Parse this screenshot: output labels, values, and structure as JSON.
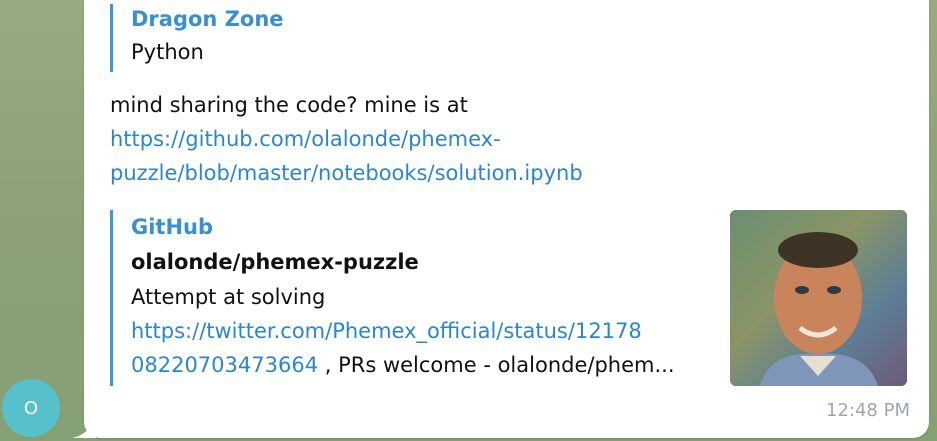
{
  "avatar": {
    "initial": "O",
    "color": "#56c0cb"
  },
  "reply": {
    "author": "Dragon Zone",
    "text": "Python"
  },
  "message": {
    "text": "mind sharing the code? mine is at",
    "link_line1": "https://github.com/olalonde/phemex-",
    "link_line2": "puzzle/blob/master/notebooks/solution.ipynb"
  },
  "preview": {
    "site": "GitHub",
    "title": "olalonde/phemex-puzzle",
    "desc_line1": "Attempt at solving",
    "desc_link1": "https://twitter.com/Phemex_official/status/12178",
    "desc_link2": "08220703473664",
    "desc_tail": " , PRs welcome - olalonde/phem..."
  },
  "timestamp": "12:48 PM",
  "colors": {
    "accent": "#3a9ad9",
    "link": "#2a86d0",
    "bubble": "#ffffff",
    "background": "#8da27a"
  }
}
